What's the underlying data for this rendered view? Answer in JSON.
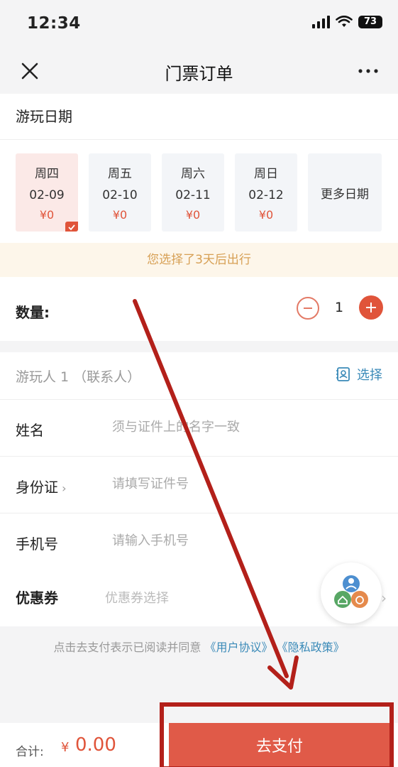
{
  "status": {
    "time": "12:34",
    "battery": "73"
  },
  "nav": {
    "title": "门票订单"
  },
  "date_section": {
    "heading": "游玩日期",
    "dates": [
      {
        "weekday": "周四",
        "date": "02-09",
        "price": "¥0",
        "selected": true
      },
      {
        "weekday": "周五",
        "date": "02-10",
        "price": "¥0",
        "selected": false
      },
      {
        "weekday": "周六",
        "date": "02-11",
        "price": "¥0",
        "selected": false
      },
      {
        "weekday": "周日",
        "date": "02-12",
        "price": "¥0",
        "selected": false
      }
    ],
    "more_label": "更多日期",
    "tip": "您选择了3天后出行"
  },
  "quantity": {
    "label": "数量:",
    "value": "1"
  },
  "visitor": {
    "title": "游玩人 1 （联系人）",
    "select_label": "选择",
    "name_label": "姓名",
    "name_placeholder": "须与证件上的名字一致",
    "id_label": "身份证",
    "id_placeholder": "请填写证件号",
    "phone_label": "手机号",
    "phone_placeholder": "请输入手机号",
    "coupon_label": "优惠券",
    "coupon_placeholder": "优惠券选择"
  },
  "agreement": {
    "text": "点击去支付表示已阅读并同意",
    "user_agreement": "《用户协议》",
    "privacy_policy": "《隐私政策》"
  },
  "bottom": {
    "total_label": "合计:",
    "currency": "¥",
    "total_value": "0.00",
    "pay_label": "去支付"
  },
  "colors": {
    "accent": "#e0543a",
    "link": "#3a8ab8",
    "tip_text": "#d7a055",
    "annotation_red": "#b3201a"
  }
}
